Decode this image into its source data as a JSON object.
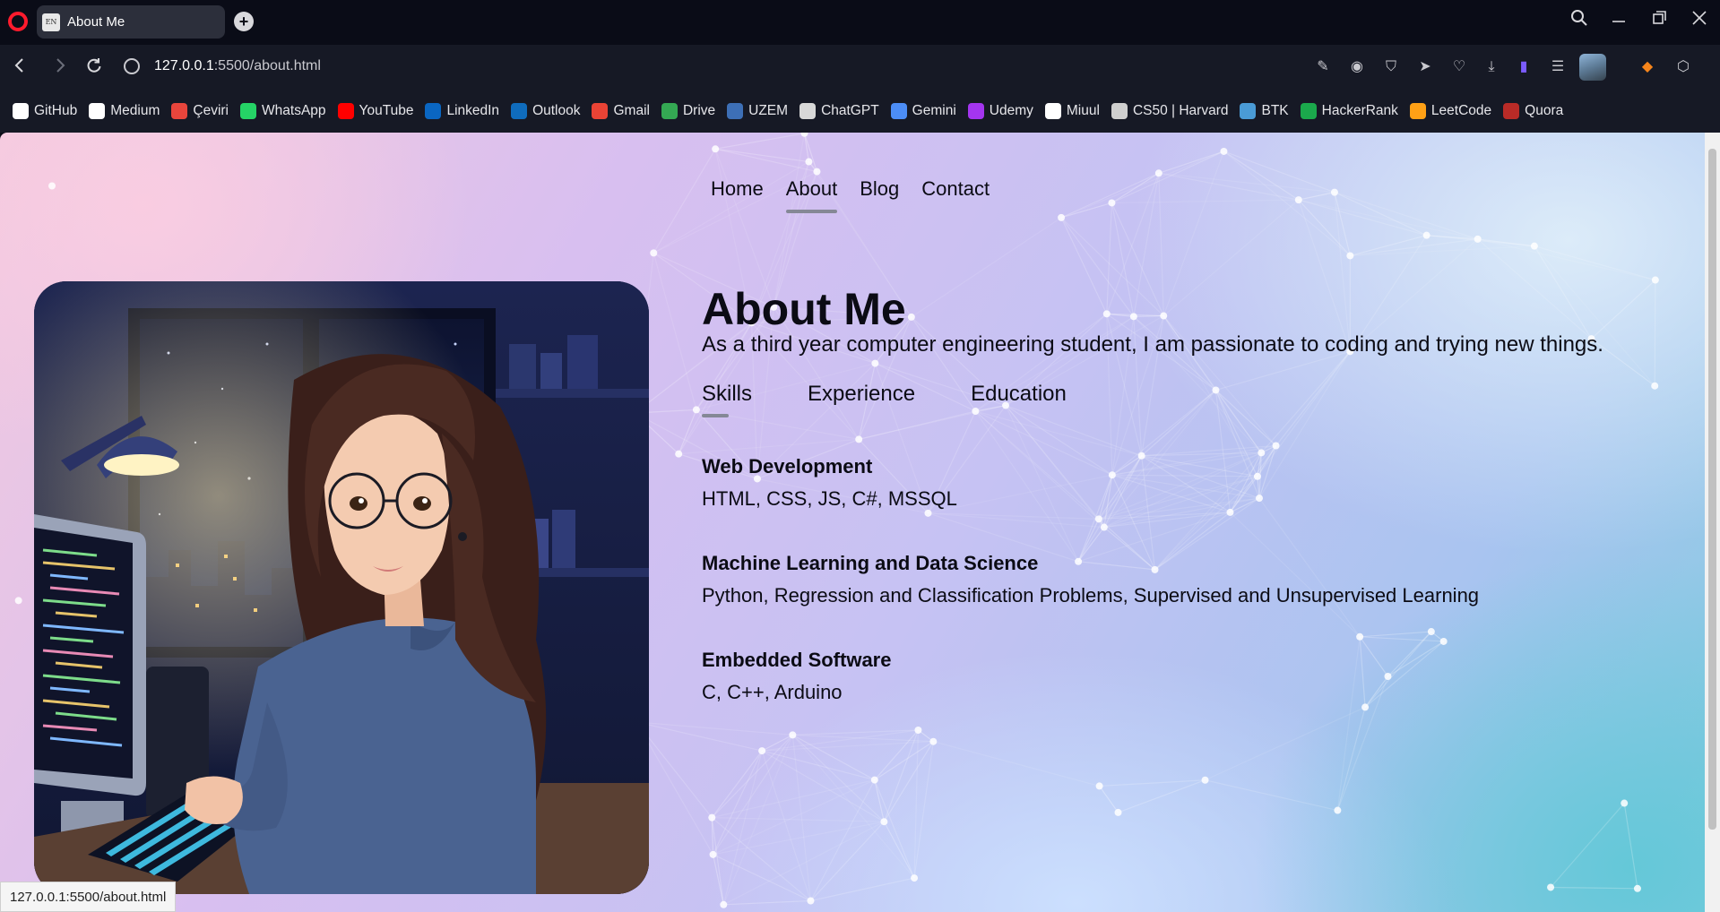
{
  "browser": {
    "tab_title": "About Me",
    "url_host": "127.0.0.1",
    "url_path": ":5500/about.html",
    "status_url": "127.0.0.1:5500/about.html",
    "bookmarks": [
      {
        "label": "GitHub",
        "icon": "github-icon",
        "color": "#ffffff"
      },
      {
        "label": "Medium",
        "icon": "medium-icon",
        "color": "#ffffff"
      },
      {
        "label": "Çeviri",
        "icon": "translate-icon",
        "color": "#e8453c"
      },
      {
        "label": "WhatsApp",
        "icon": "whatsapp-icon",
        "color": "#25d366"
      },
      {
        "label": "YouTube",
        "icon": "youtube-icon",
        "color": "#ff0000"
      },
      {
        "label": "LinkedIn",
        "icon": "linkedin-icon",
        "color": "#0a66c2"
      },
      {
        "label": "Outlook",
        "icon": "outlook-icon",
        "color": "#0f6cbd"
      },
      {
        "label": "Gmail",
        "icon": "gmail-icon",
        "color": "#ea4335"
      },
      {
        "label": "Drive",
        "icon": "drive-icon",
        "color": "#34a853"
      },
      {
        "label": "UZEM",
        "icon": "uzem-icon",
        "color": "#3d6fb6"
      },
      {
        "label": "ChatGPT",
        "icon": "chatgpt-icon",
        "color": "#d8d8d8"
      },
      {
        "label": "Gemini",
        "icon": "gemini-icon",
        "color": "#4c8df6"
      },
      {
        "label": "Udemy",
        "icon": "udemy-icon",
        "color": "#a435f0"
      },
      {
        "label": "Miuul",
        "icon": "miuul-icon",
        "color": "#ffffff"
      },
      {
        "label": "CS50 | Harvard",
        "icon": "edx-icon",
        "color": "#cfcfcf"
      },
      {
        "label": "BTK",
        "icon": "btk-icon",
        "color": "#4a9bd6"
      },
      {
        "label": "HackerRank",
        "icon": "hackerrank-icon",
        "color": "#1ba94c"
      },
      {
        "label": "LeetCode",
        "icon": "leetcode-icon",
        "color": "#ffa116"
      },
      {
        "label": "Quora",
        "icon": "quora-icon",
        "color": "#b92b27"
      }
    ]
  },
  "site": {
    "nav": [
      "Home",
      "About",
      "Blog",
      "Contact"
    ],
    "active_nav": "About",
    "heading": "About Me",
    "intro": "As a third year computer engineering student, I am passionate to coding and trying new things.",
    "tabs": [
      "Skills",
      "Experience",
      "Education"
    ],
    "active_tab": "Skills",
    "skills": [
      {
        "title": "Web Development",
        "detail": "HTML, CSS, JS, C#, MSSQL"
      },
      {
        "title": "Machine Learning and Data Science",
        "detail": "Python, Regression and Classification Problems, Supervised and Unsupervised Learning"
      },
      {
        "title": "Embedded Software",
        "detail": "C, C++, Arduino"
      }
    ]
  }
}
